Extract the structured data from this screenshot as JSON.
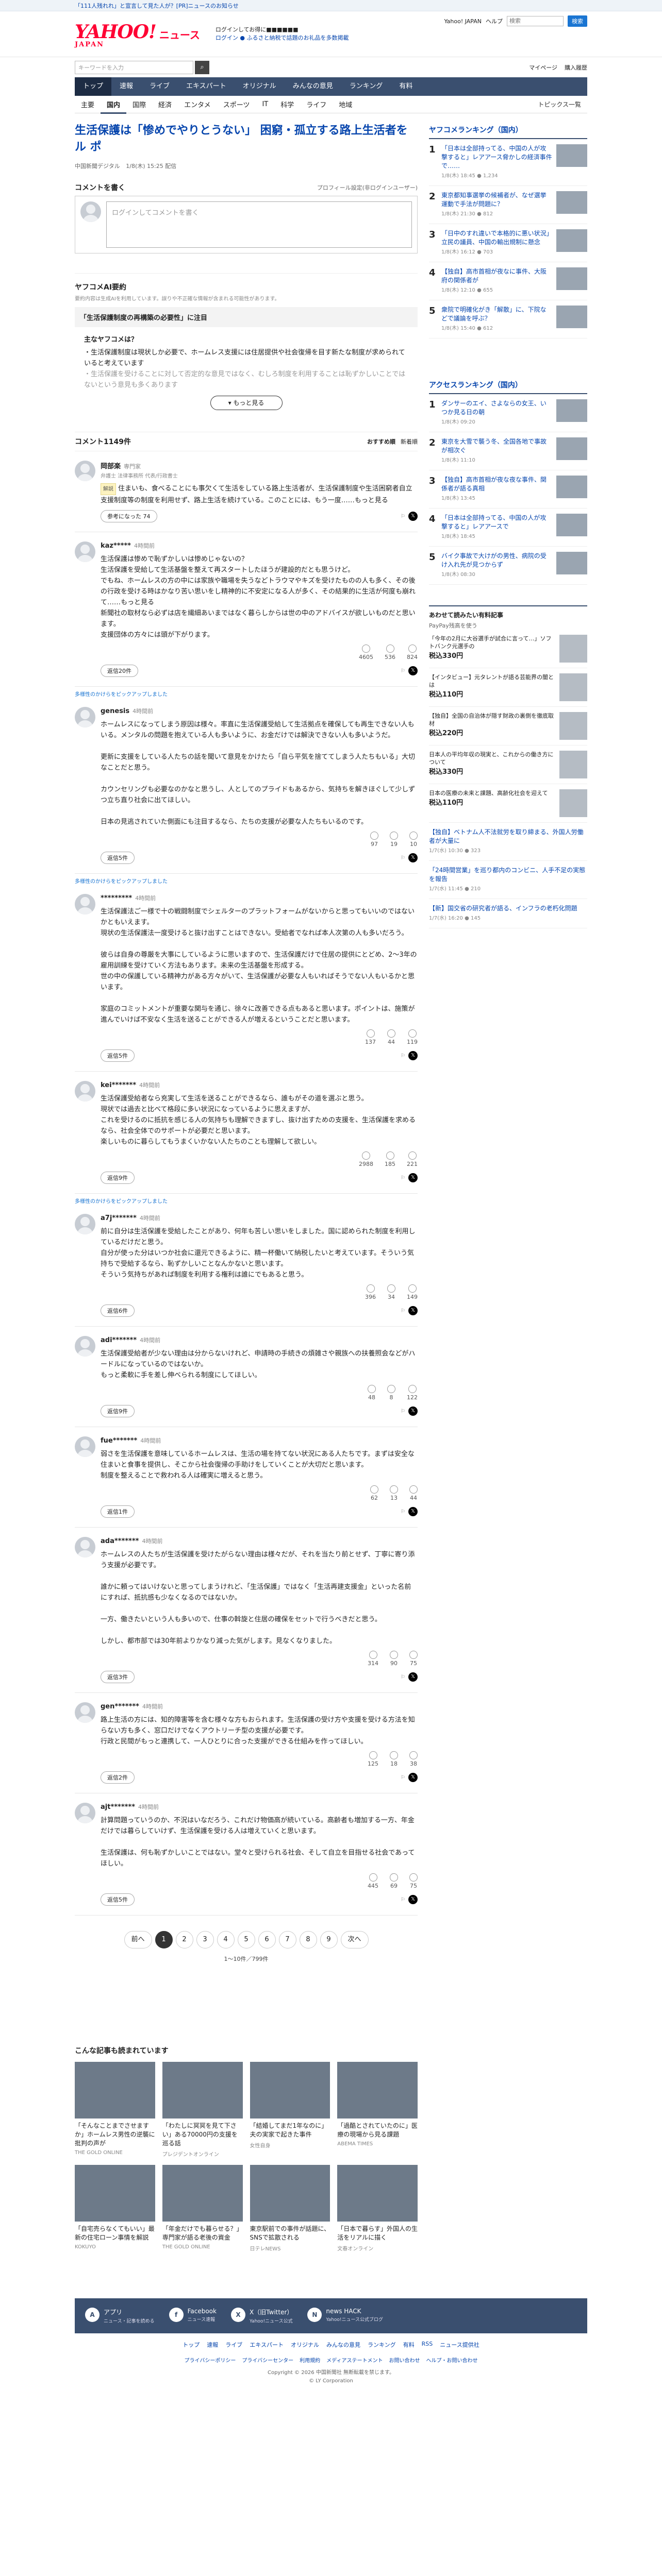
{
  "topbar": {
    "promo": "「111人残れれ」と宣言して見た人が？[PR]ニュースのお知らせ"
  },
  "header": {
    "logo": "YAHOO!",
    "logo_sub": "JAPAN",
    "logo_news": "ニュース",
    "tagline1": "ログインしてお得に■■■■■■",
    "tagline2": "ログイン ● ふるさと納税で話題のお礼品を多数掲載",
    "yahoo_japan": "Yahoo! JAPAN",
    "help": "ヘルプ",
    "search_placeholder": "検索",
    "search_btn": "検索"
  },
  "search": {
    "placeholder": "キーワードを入力",
    "my_page": "マイページ",
    "register": "購入履歴"
  },
  "nav": [
    "トップ",
    "速報",
    "ライブ",
    "エキスパート",
    "オリジナル",
    "みんなの意見",
    "ランキング",
    "有料"
  ],
  "subnav": [
    "主要",
    "国内",
    "国際",
    "経済",
    "エンタメ",
    "スポーツ",
    "IT",
    "科学",
    "ライフ",
    "地域"
  ],
  "subnav_right": "トピックス一覧",
  "article": {
    "title": "生活保護は「惨めでやりとうない」 困窮・孤立する路上生活者をル ポ",
    "source": "中国新聞デジタル",
    "date": "1/8(木) 15:25 配信"
  },
  "comment_entry": {
    "title": "コメントを書く",
    "policy": "プロフィール設定(非ログインユーザー)",
    "placeholder": "ログインしてコメントを書く"
  },
  "ai": {
    "title": "ヤフコメAI要約",
    "note": "要約内容は生成AIを利用しています。誤りや不正確な情報が含まれる可能性があります。",
    "banner": "「生活保護制度の再構築の必要性」に注目",
    "points_head": "主なヤフコメは？",
    "point1": "生活保護制度は現状しか必要で、ホームレス支援には住居提供や社会復帰を目す新たな制度が求められていると考えています",
    "point2": "生活保護を受けることに対して否定的な意見ではなく、むしろ制度を利用することは恥ずかしいことではないという意見も多くあります",
    "more": "もっと見る"
  },
  "comments_header": {
    "count": "コメント1149件",
    "tab1": "おすすめ順",
    "tab2": "新着順"
  },
  "comments": [
    {
      "name": "岡部楽",
      "label": "専門家",
      "prof": "弁護士 法律事務所 代表/行政書士",
      "tag": "解説",
      "text": "住まいも、食べることにも事欠くて生活をしている路上生活者が、生活保護制度や生活困窮者自立支援制度等の制度を利用せず、路上生活を続けている。このことには、もう一度……もっと見る",
      "useful": "参考になった 74"
    },
    {
      "name": "kaz*****",
      "label": "4時間前",
      "text": "生活保護は惨めで恥ずかしいは惨めじゃないの？\n生活保護を受給して生活基盤を整えて再スタートしたほうが建設的だとも思うけど。\nでもね、ホームレスの方の中には家族や職場を失うなどトラウマやキズを受けたものの人も多く、その後の行政を受ける時はかなり苦い思いをし精神的に不安定になる人が多く、その結果的に生活が何度も崩れて……もっと見る\n新聞社の取材なら必ずは店を繊細あいまではなく暮らしからは世の中のアドバイスが欲しいものだと思います。\n支援団体の方々には頭が下がります。",
      "r1": "4605",
      "r2": "536",
      "r3": "824",
      "more": "返信20件"
    },
    {
      "name": "genesis",
      "label": "4時間前",
      "pick": "多様性のかけらをピックアップしました",
      "text": "ホームレスになってしまう原因は様々。率直に生活保護受給して生活拠点を確保しても再生できない人もいる。メンタルの問題を抱えている人も多いように、お金だけでは解決できない人も多いようだ。\n\n更新に支援をしている人たちの話を聞いて意見をかけたら「自ら平気を捨ててしまう人たちもいる」大切なことだと思う。\n\nカウンセリングも必要なのかなと思うし、人としてのプライドもあるから、気持ちを解きほぐして少しずつ立ち直り社会に出てほしい。\n\n日本の見逃されていた側面にも注目するなら、たちの支援が必要な人たちもいるのです。",
      "r1": "97",
      "r2": "19",
      "r3": "10",
      "more": "返信5件"
    },
    {
      "name": "*********",
      "label": "4時間前",
      "pick": "多様性のかけらをピックアップしました",
      "text": "生活保護法ご一様で十の戦闘制度でシェルターのプラットフォームがないからと思ってもいいのではないかともいえます。\n現状の生活保護法一度受けると抜け出すことはできない。受給者でなれば本人次第の人も多いだろう。\n\n彼らは自身の尊厳を大事にしているように思いますので、生活保護だけで住居の提供にとどめ、2～3年の雇用訓練を受けていく方法もあります。未来の生活基盤を形成する。\n世の中の保護している精神力がある方々がいて、生活保護が必要な人もいればそうでない人もいるかと思います。\n\n家庭のコミットメントが重要な関与を通じ、徐々に改善できる点もあると思います。ポイントは、施策が進んでいけば不安なく生活を送ることができる人が増えるということだと思います。",
      "r1": "137",
      "r2": "44",
      "r3": "119",
      "more": "返信5件"
    },
    {
      "name": "kei*******",
      "label": "4時間前",
      "text": "生活保護受給者なら充実して生活を送ることができるなら、誰もがその道を選ぶと思う。\n現状では過去と比べて格段に多い状況になっているように思えますが、\nこれを受けるのに抵抗を感じる人の気持ちも理解できますし、抜け出すための支援を、生活保護を求めるなら、社会全体でのサポートが必要だと思います。\n楽しいものに暮らしてもうまくいかない人たちのことも理解して欲しい。",
      "r1": "2988",
      "r2": "185",
      "r3": "221",
      "more": "返信9件"
    },
    {
      "name": "a7j*******",
      "label": "4時間前",
      "pick": "多様性のかけらをピックアップしました",
      "text": "前に自分は生活保護を受給したことがあり、何年も苦しい思いをしました。国に認められた制度を利用しているだけだと思う。\n自分が使った分はいつか社会に還元できるように、精一杯働いて納税したいと考えています。そういう気持ちで受給するなら、恥ずかしいことなんかないと思います。\nそういう気持ちがあれば制度を利用する権利は誰にでもあると思う。",
      "r1": "396",
      "r2": "34",
      "r3": "149",
      "more": "返信6件"
    },
    {
      "name": "adi*******",
      "label": "4時間前",
      "text": "生活保護受給者が少ない理由は分からないけれど、申請時の手続きの煩雑さや親族への扶養照会などがハードルになっているのではないか。\nもっと柔軟に手を差し伸べられる制度にしてほしい。",
      "r1": "48",
      "r2": "8",
      "r3": "122",
      "more": "返信9件"
    },
    {
      "name": "fue*******",
      "label": "4時間前",
      "text": "弱さを生活保護を意味しているホームレスは、生活の場を持てない状況にある人たちです。まずは安全な住まいと食事を提供し、そこから社会復帰の手助けをしていくことが大切だと思います。\n制度を整えることで救われる人は確実に増えると思う。",
      "r1": "62",
      "r2": "13",
      "r3": "44",
      "more": "返信1件"
    },
    {
      "name": "ada*******",
      "label": "4時間前",
      "text": "ホームレスの人たちが生活保護を受けたがらない理由は様々だが、それを当たり前とせず、丁寧に寄り添う支援が必要です。\n\n誰かに頼ってはいけないと思ってしまうけれど、「生活保護」ではなく「生活再建支援金」といった名前にすれば、抵抗感も少なくなるのではないか。\n\n一方、働きたいという人も多いので、仕事の斡旋と住居の確保をセットで行うべきだと思う。\n\nしかし、都市部では30年前よりかなり減った気がします。見なくなりました。",
      "r1": "314",
      "r2": "90",
      "r3": "75",
      "more": "返信3件"
    },
    {
      "name": "gen*******",
      "label": "4時間前",
      "text": "路上生活の方には、知的障害等を含む様々な方もおられます。生活保護の受け方や支援を受ける方法を知らない方も多く、窓口だけでなくアウトリーチ型の支援が必要です。\n行政と民間がもっと連携して、一人ひとりに合った支援ができる仕組みを作ってほしい。",
      "r1": "125",
      "r2": "18",
      "r3": "38",
      "more": "返信2件"
    },
    {
      "name": "ajt*******",
      "label": "4時間前",
      "text": "計算問題っていうのか、不況はいなだろう、これだけ物価高が続いている。高齢者も増加する一方、年金だけでは暮らしていけず、生活保護を受ける人は増えていくと思います。\n\n生活保護は、何も恥ずかしいことではない。堂々と受けられる社会、そして自立を目指せる社会であってほしい。",
      "r1": "445",
      "r2": "69",
      "r3": "75",
      "more": "返信5件"
    }
  ],
  "pager": {
    "prev": "前へ",
    "pages": [
      "1",
      "2",
      "3",
      "4",
      "5",
      "6",
      "7",
      "8",
      "9"
    ],
    "next": "次へ",
    "count": "1〜10件／799件"
  },
  "rank1": {
    "title": "ヤフコメランキング（国内）",
    "items": [
      {
        "n": "1",
        "t": "「日本は全部持ってる、中国の人が攻撃すると」レアアース脅かしの経済事件で……",
        "s": "1/8(木) 18:45 ● 1,234"
      },
      {
        "n": "2",
        "t": "東京都知事選挙の候補者が、なぜ選挙運動で手法が問題に？",
        "s": "1/8(木) 21:30 ● 812"
      },
      {
        "n": "3",
        "t": "「日中のすれ違いで本格的に悪い状況」立民の議員、中国の輸出規制に懸念",
        "s": "1/8(木) 16:12 ● 703"
      },
      {
        "n": "4",
        "t": "【独自】高市首相が夜なに事件、大阪府の関係者が",
        "s": "1/8(木) 12:10 ● 655"
      },
      {
        "n": "5",
        "t": "衆院で明確化がき「解散」に、下院などで議論を呼ぶ？",
        "s": "1/8(木) 15:40 ● 612"
      }
    ]
  },
  "rank2": {
    "title": "アクセスランキング（国内）",
    "items": [
      {
        "n": "1",
        "t": "ダンサーのエイ、さよならの女王、いつか見る日の朝",
        "s": "1/8(木) 09:20"
      },
      {
        "n": "2",
        "t": "東京を大雪で襲う冬、全国各地で事故が相次ぐ",
        "s": "1/8(木) 11:10"
      },
      {
        "n": "3",
        "t": "【独自】高市首相が夜な夜な事件、関係者が語る真相",
        "s": "1/8(木) 13:45"
      },
      {
        "n": "4",
        "t": "「日本は全部持ってる、中国の人が攻撃すると」レアアースで",
        "s": "1/8(木) 18:45"
      },
      {
        "n": "5",
        "t": "バイク事故で大けがの男性、病院の受け入れ先が見つからず",
        "s": "1/8(木) 08:30"
      }
    ]
  },
  "ads": {
    "title": "あわせて読みたい有料記事",
    "sub": "PayPay残高を使う",
    "items": [
      {
        "t": "「今年の2月に大谷選手が試合に言って…」ソフトバンク元選手の",
        "p": "税込330円"
      },
      {
        "t": "【インタビュー】元タレントが語る芸能界の闇とは",
        "p": "税込110円"
      },
      {
        "t": "【独自】全国の自治体が隠す財政の裏側を徹底取材",
        "p": "税込220円"
      },
      {
        "t": "日本人の平均年収の現実と、これからの働き方について",
        "p": "税込330円"
      },
      {
        "t": "日本の医療の未来と課題、高齢化社会を迎えて",
        "p": "税込110円"
      }
    ]
  },
  "plain_news": [
    {
      "t": "【独自】ベトナム人不法就労を取り締まる、外国人労働者が大量に",
      "s": "1/7(水) 10:30 ● 323"
    },
    {
      "t": "「24時間営業」を巡り都内のコンビニ、人手不足の実態を報告",
      "s": "1/7(水) 11:45 ● 210"
    },
    {
      "t": "【新】国交省の研究者が語る、インフラの老朽化問題",
      "s": "1/7(水) 16:20 ● 145"
    }
  ],
  "reco": {
    "title": "こんな記事も読まれています",
    "items": [
      {
        "t": "「そんなことまでさせますか」ホームレス男性の逆襲に批判の声が",
        "s": "THE GOLD ONLINE"
      },
      {
        "t": "「わたしに冥冥を見て下さい」ある70000円の支援を巡る話",
        "s": "プレジデントオンライン"
      },
      {
        "t": "「結婚してまだ1年なのに」夫の実家で起きた事件",
        "s": "女性自身"
      },
      {
        "t": "「過酷とされていたのに」医療の現場から見る課題",
        "s": "ABEMA TIMES"
      },
      {
        "t": "「自宅売らなくてもいい」最新の住宅ローン事情を解説",
        "s": "KOKUYO"
      },
      {
        "t": "「年金だけでも暮らせる？」専門家が語る老後の資金",
        "s": "THE GOLD ONLINE"
      },
      {
        "t": "東京駅前での事件が話題に、SNSで拡散される",
        "s": "日テレNEWS"
      },
      {
        "t": "「日本で暮らす」外国人の生活をリアルに描く",
        "s": "文春オンライン"
      }
    ]
  },
  "footer": {
    "items": [
      {
        "ic": "A",
        "t": "アプリ",
        "s": "ニュース・記事を読める"
      },
      {
        "ic": "f",
        "t": "Facebook",
        "s": "ニュース速報"
      },
      {
        "ic": "X",
        "t": "X（旧Twitter）",
        "s": "Yahoo!ニュース公式"
      },
      {
        "ic": "N",
        "t": "news HACK",
        "s": "Yahoo!ニュース公式ブログ"
      }
    ],
    "links": [
      "トップ",
      "速報",
      "ライブ",
      "エキスパート",
      "オリジナル",
      "みんなの意見",
      "ランキング",
      "有料",
      "RSS",
      "ニュース提供社"
    ],
    "links2": [
      "プライバシーポリシー",
      "プライバシーセンター",
      "利用規約",
      "メディアステートメント",
      "お問い合わせ",
      "ヘルプ・お問い合わせ"
    ],
    "copy1": "Copyright © 2026 中国新聞社 無断転載を禁じます。",
    "copy2": "© LY Corporation"
  }
}
